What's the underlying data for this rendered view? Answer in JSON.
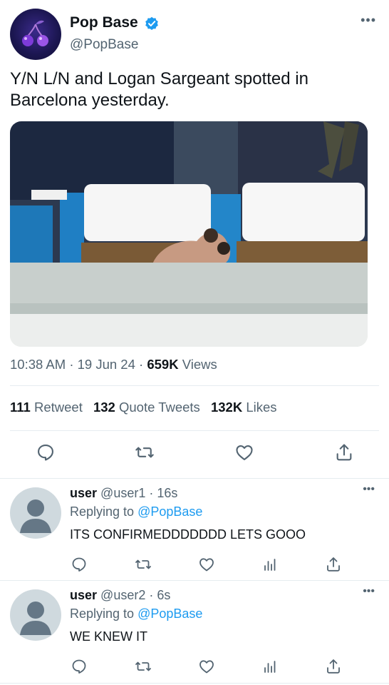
{
  "tweet": {
    "author_name": "Pop Base",
    "author_handle": "@PopBase",
    "text": "Y/N L/N and Logan Sargeant spotted in Barcelona yesterday.",
    "time": "10:38 AM",
    "date": "19 Jun 24",
    "views_count": "659K",
    "views_label": "Views",
    "sep": "·",
    "retweets_count": "111",
    "retweets_label": "Retweet",
    "quotes_count": "132",
    "quotes_label": "Quote Tweets",
    "likes_count": "132K",
    "likes_label": "Likes",
    "more": "•••",
    "icons": [
      "reply-icon",
      "retweet-icon",
      "like-icon",
      "share-icon"
    ]
  },
  "replies": [
    {
      "name": "user",
      "handle": "@user1",
      "sep": "·",
      "time": "16s",
      "replying_label": "Replying to",
      "replying_to": "@PopBase",
      "text": "ITS CONFIRMEDDDDDDD LETS GOOO",
      "more": "•••"
    },
    {
      "name": "user",
      "handle": "@user2",
      "sep": "·",
      "time": "6s",
      "replying_label": "Replying to",
      "replying_to": "@PopBase",
      "text": "WE KNEW IT",
      "more": "•••"
    }
  ],
  "colors": {
    "accent": "#1d9bf0",
    "text": "#0f1419",
    "secondary": "#536471",
    "divider": "#e6ecf0"
  }
}
